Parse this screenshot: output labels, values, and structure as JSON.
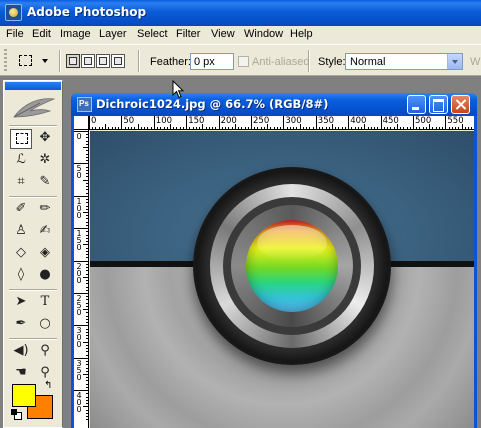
{
  "app": {
    "title": "Adobe Photoshop"
  },
  "menu": [
    "File",
    "Edit",
    "Image",
    "Layer",
    "Select",
    "Filter",
    "View",
    "Window",
    "Help"
  ],
  "options": {
    "feather_label": "Feather:",
    "feather_value": "0 px",
    "antialiased_label": "Anti-aliased",
    "style_label": "Style:",
    "style_value": "Normal",
    "width_label_partial": "W"
  },
  "document": {
    "title": "Dichroic1024.jpg @ 66.7% (RGB/8#)",
    "h_ruler_labels": [
      "0",
      "50",
      "100",
      "150",
      "200",
      "250",
      "300",
      "350",
      "400",
      "450",
      "500",
      "550"
    ],
    "v_ruler_labels": [
      "0",
      "50",
      "100",
      "150",
      "200",
      "250",
      "300",
      "350",
      "400"
    ]
  },
  "colors": {
    "foreground": "#ffff00",
    "background": "#ff8000",
    "titlebar": "#0a5fdf"
  },
  "tools": [
    "rectangular-marquee-tool",
    "move-tool",
    "lasso-tool",
    "magic-wand-tool",
    "crop-tool",
    "slice-tool",
    "healing-brush-tool",
    "brush-tool",
    "clone-stamp-tool",
    "history-brush-tool",
    "eraser-tool",
    "paint-bucket-tool",
    "blur-tool",
    "dodge-tool",
    "path-selection-tool",
    "type-tool",
    "pen-tool",
    "ellipse-tool",
    "notes-tool",
    "eyedropper-tool",
    "hand-tool",
    "zoom-tool"
  ]
}
